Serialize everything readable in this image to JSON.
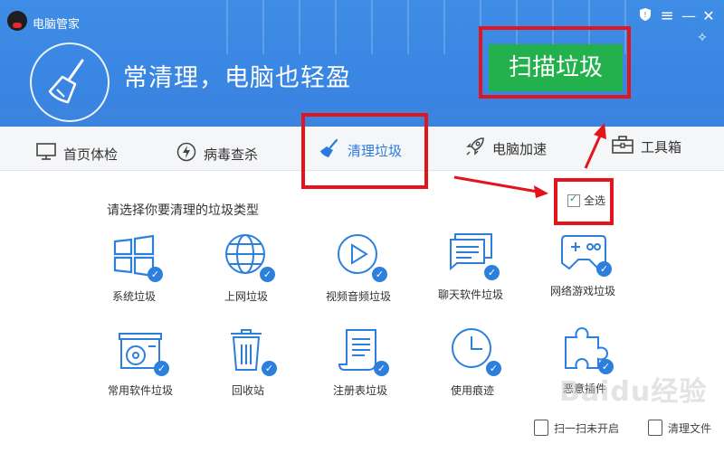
{
  "app": {
    "title": "电脑管家",
    "slogan": "常清理，电脑也轻盈",
    "scan_button": "扫描垃圾"
  },
  "tabs": [
    {
      "label": "首页体检",
      "icon": "monitor-icon"
    },
    {
      "label": "病毒查杀",
      "icon": "lightning-icon"
    },
    {
      "label": "清理垃圾",
      "icon": "broom-icon",
      "active": true
    },
    {
      "label": "电脑加速",
      "icon": "rocket-icon"
    },
    {
      "label": "工具箱",
      "icon": "toolbox-icon"
    }
  ],
  "content": {
    "section_title": "请选择你要清理的垃圾类型",
    "select_all": "全选",
    "categories": [
      {
        "label": "系统垃圾",
        "icon": "windows-icon",
        "checked": true
      },
      {
        "label": "上网垃圾",
        "icon": "globe-icon",
        "checked": true
      },
      {
        "label": "视频音频垃圾",
        "icon": "play-icon",
        "checked": true
      },
      {
        "label": "聊天软件垃圾",
        "icon": "chat-icon",
        "checked": true
      },
      {
        "label": "网络游戏垃圾",
        "icon": "gamepad-icon",
        "checked": true
      },
      {
        "label": "常用软件垃圾",
        "icon": "software-box-icon",
        "checked": true
      },
      {
        "label": "回收站",
        "icon": "trash-icon",
        "checked": true
      },
      {
        "label": "注册表垃圾",
        "icon": "registry-doc-icon",
        "checked": true
      },
      {
        "label": "使用痕迹",
        "icon": "clock-icon",
        "checked": true
      },
      {
        "label": "恶意插件",
        "icon": "puzzle-icon",
        "checked": true
      }
    ]
  },
  "footer": {
    "scan_unopened": "扫一扫未开启",
    "cleanup_files": "清理文件"
  },
  "watermark": "Baidu经验",
  "colors": {
    "header_blue": "#3b87e3",
    "scan_green": "#23b14d",
    "check_blue": "#2c7fdc",
    "annotation_red": "#e3141b"
  }
}
